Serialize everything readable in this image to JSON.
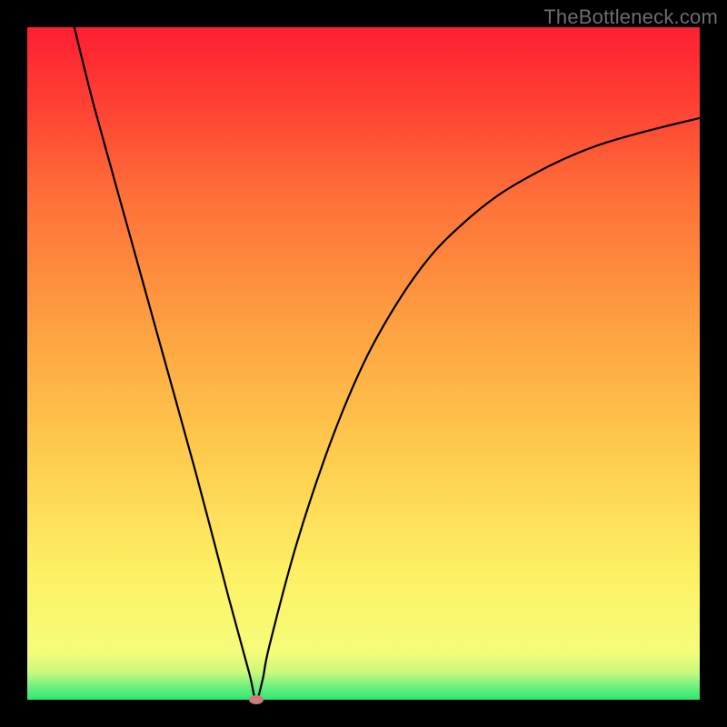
{
  "watermark": "TheBottleneck.com",
  "chart_data": {
    "type": "line",
    "title": "",
    "xlabel": "",
    "ylabel": "",
    "xlim": [
      0,
      100
    ],
    "ylim": [
      0,
      100
    ],
    "grid": false,
    "legend": false,
    "series": [
      {
        "name": "bottleneck-curve",
        "x": [
          7,
          10,
          15,
          20,
          25,
          30,
          33,
          34,
          35,
          36,
          40,
          45,
          50,
          55,
          60,
          65,
          70,
          75,
          80,
          85,
          90,
          95,
          100
        ],
        "y": [
          100,
          88,
          70,
          52,
          34,
          15,
          4,
          0,
          3,
          8,
          23,
          38,
          50,
          59,
          66,
          71,
          75,
          78,
          80.5,
          82.5,
          84,
          85.3,
          86.5
        ]
      }
    ],
    "markers": [
      {
        "name": "minimum-point",
        "x": 34,
        "y": 0,
        "color": "#d07a7a"
      }
    ],
    "background_gradient_top": "#fe1f33",
    "background_gradient_bottom": "#2ee66f"
  }
}
